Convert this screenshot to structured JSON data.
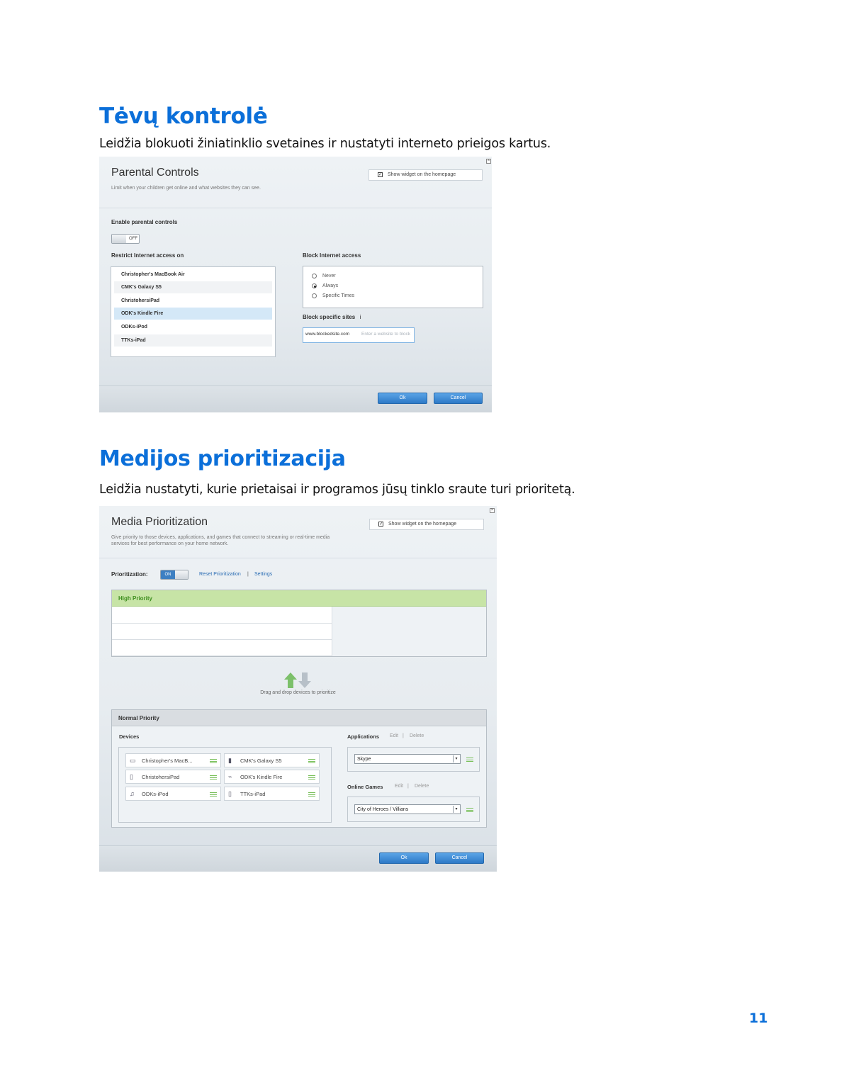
{
  "sections": {
    "parental": {
      "heading": "Tėvų kontrolė",
      "description": "Leidžia blokuoti žiniatinklio svetaines ir nustatyti interneto prieigos kartus."
    },
    "media": {
      "heading": "Medijos prioritizacija",
      "description": "Leidžia nustatyti, kurie prietaisai ir programos jūsų tinklo sraute turi prioritetą."
    }
  },
  "parental_controls": {
    "title": "Parental Controls",
    "subtitle": "Limit when your children get online and what websites they can see.",
    "widget_label": "Show widget on the homepage",
    "widget_checked": true,
    "enable_label": "Enable parental controls",
    "toggle_state": "OFF",
    "restrict_label": "Restrict Internet access on",
    "devices": [
      "Christopher's MacBook Air",
      "CMK's Galaxy S5",
      "ChristohersiPad",
      "ODK's Kindle Fire",
      "ODKs-iPod",
      "TTKs-iPad"
    ],
    "block_access_label": "Block Internet access",
    "block_options": [
      "Never",
      "Always",
      "Specific Times"
    ],
    "block_selected": "Always",
    "block_sites_label": "Block specific sites",
    "site_value": "www.blockedsite.com",
    "site_placeholder": "Enter a website to block",
    "ok_label": "Ok",
    "cancel_label": "Cancel"
  },
  "media_prioritization": {
    "title": "Media Prioritization",
    "subtitle_line1": "Give priority to those devices, applications, and games that connect to streaming or real-time media",
    "subtitle_line2": "services for best performance on your home network.",
    "widget_label": "Show widget on the homepage",
    "widget_checked": true,
    "prioritization_label": "Prioritization:",
    "toggle_state": "ON",
    "reset_link": "Reset Prioritization",
    "separator": "|",
    "settings_link": "Settings",
    "high_priority_label": "High Priority",
    "drag_hint": "Drag and drop devices to prioritize",
    "normal_priority_label": "Normal Priority",
    "devices_label": "Devices",
    "devices": [
      {
        "name": "Christopher's MacB...",
        "icon": "laptop-icon"
      },
      {
        "name": "CMK's Galaxy S5",
        "icon": "phone-icon"
      },
      {
        "name": "ChristohersiPad",
        "icon": "tablet-icon"
      },
      {
        "name": "ODK's Kindle Fire",
        "icon": "kindle-icon"
      },
      {
        "name": "ODKs-iPod",
        "icon": "ipod-icon"
      },
      {
        "name": "TTKs-iPad",
        "icon": "tablet-icon"
      }
    ],
    "applications_label": "Applications",
    "edit_label": "Edit",
    "delete_label": "Delete",
    "application_value": "Skype",
    "online_games_label": "Online Games",
    "game_value": "City of Heroes / Villians",
    "ok_label": "Ok",
    "cancel_label": "Cancel"
  },
  "colors": {
    "heading_blue": "#0b6fd9",
    "high_priority_green": "#c7e4a6",
    "button_blue": "#2d79c7"
  },
  "page_number": "11"
}
